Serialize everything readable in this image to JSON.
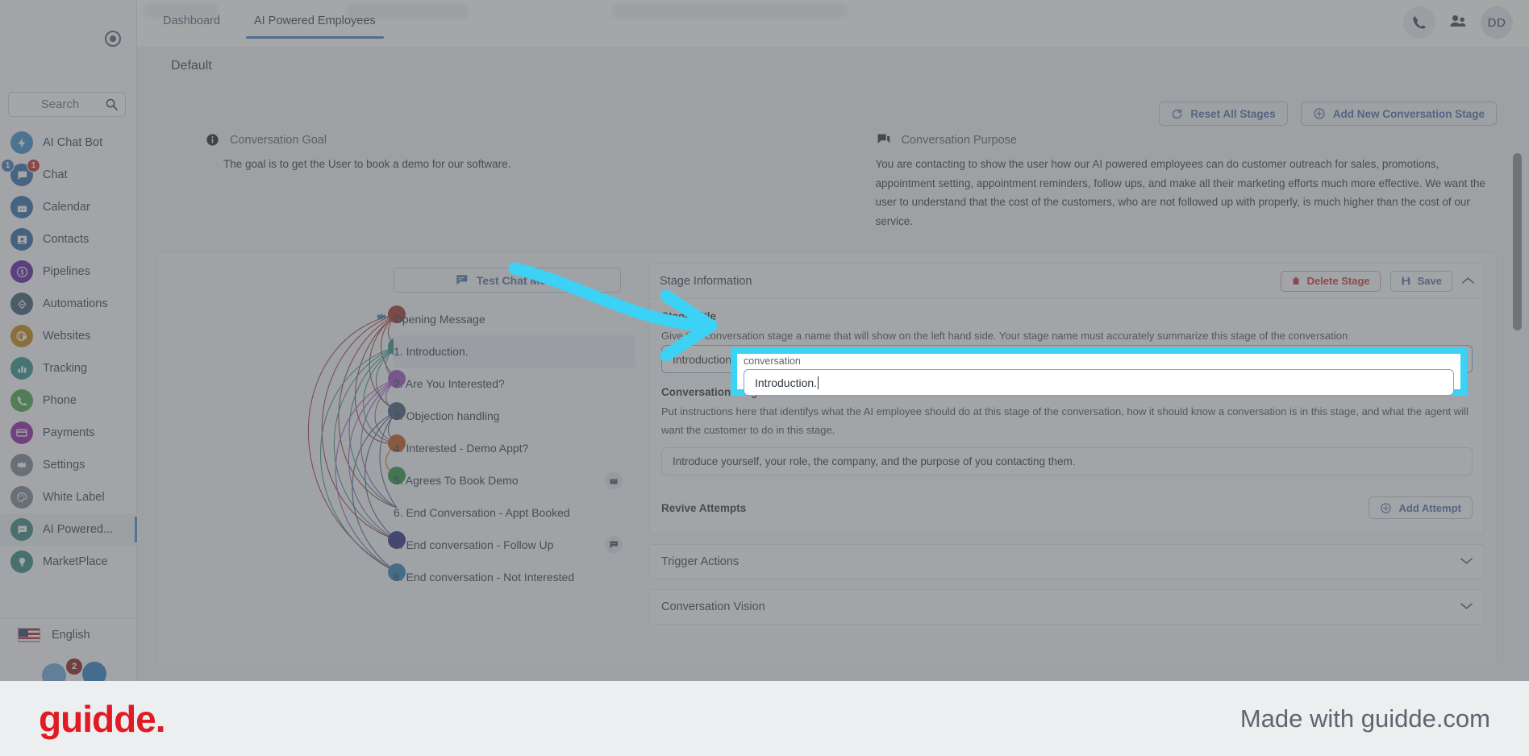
{
  "sidebar": {
    "search_placeholder": "Search",
    "items": [
      {
        "label": "AI Chat Bot",
        "icon": "bolt-icon",
        "color": "#3f8fd0"
      },
      {
        "label": "Chat",
        "icon": "chat-icon",
        "color": "#2f6fae",
        "badge_left": "1",
        "badge_right": "1"
      },
      {
        "label": "Calendar",
        "icon": "calendar-icon",
        "color": "#2d6bab"
      },
      {
        "label": "Contacts",
        "icon": "contacts-icon",
        "color": "#2c68a6"
      },
      {
        "label": "Pipelines",
        "icon": "dollar-icon",
        "color": "#5c1e9e"
      },
      {
        "label": "Automations",
        "icon": "automations-icon",
        "color": "#3b5a72"
      },
      {
        "label": "Websites",
        "icon": "globe-icon",
        "color": "#c8860d"
      },
      {
        "label": "Tracking",
        "icon": "bars-icon",
        "color": "#2f9189"
      },
      {
        "label": "Phone",
        "icon": "phone-icon",
        "color": "#4aa547"
      },
      {
        "label": "Payments",
        "icon": "card-icon",
        "color": "#8d1fa5"
      },
      {
        "label": "Settings",
        "icon": "gear-icon",
        "color": "#7c8592"
      },
      {
        "label": "White Label",
        "icon": "palette-icon",
        "color": "#7c8592"
      },
      {
        "label": "AI Powered...",
        "icon": "ai-chat-icon",
        "color": "#35857e",
        "active": true
      },
      {
        "label": "MarketPlace",
        "icon": "bulb-icon",
        "color": "#2f8a80"
      }
    ],
    "language": "English",
    "chat_badge": "2"
  },
  "topbar": {
    "tabs": [
      {
        "label": "Dashboard",
        "active": false
      },
      {
        "label": "AI Powered Employees",
        "active": true
      }
    ],
    "phone_icon": "phone-icon",
    "people_icon": "people-icon",
    "avatar_initials": "DD"
  },
  "page": {
    "title": "Default",
    "reset_button": "Reset All Stages",
    "add_stage_button": "Add New Conversation Stage",
    "goal": {
      "heading": "Conversation Goal",
      "icon": "info-icon",
      "text": "The goal is to get the User to book a demo for our software."
    },
    "purpose": {
      "heading": "Conversation Purpose",
      "icon": "speech-icon",
      "text": "You are contacting to show the user how our AI powered employees can do customer outreach for sales, promotions, appointment setting, appointment reminders, follow ups, and make all their marketing efforts much more effective. We want the user to understand that the cost of the customers, who are not followed up with properly, is much higher than the cost of our service."
    }
  },
  "stages": {
    "test_chat_button": "Test Chat Mode",
    "opening": {
      "label": "Opening Message",
      "icon": "gear-icon"
    },
    "items": [
      {
        "label": "1. Introduction.",
        "color": "#a2312d",
        "active": true,
        "trailing_icon": null
      },
      {
        "label": "2. Are You Interested?",
        "color": "#329086",
        "active": false,
        "trailing_icon": null
      },
      {
        "label": "3. Objection handling",
        "color": "#9b4fc0",
        "active": false,
        "trailing_icon": null
      },
      {
        "label": "4. Interested - Demo Appt?",
        "color": "#44597c",
        "active": false,
        "trailing_icon": null
      },
      {
        "label": "5. Agrees To Book Demo",
        "color": "#c0561f",
        "active": false,
        "trailing_icon": "calendar-icon"
      },
      {
        "label": "6. End Conversation - Appt Booked",
        "color": "#2a9440",
        "active": false,
        "trailing_icon": null
      },
      {
        "label": "7. End conversation - Follow Up",
        "color": "#2e2a85",
        "active": false,
        "trailing_icon": "chat-icon"
      },
      {
        "label": "8. End conversation - Not Interested",
        "color": "#2f82b8",
        "active": false,
        "trailing_icon": null
      }
    ]
  },
  "stage_panel": {
    "header": "Stage Information",
    "delete_button": "Delete Stage",
    "save_button": "Save",
    "collapse_icon": "chevron-up-icon",
    "stage_title_label": "Stage Title",
    "stage_title_help": "Give this conversation stage a name that will show on the left hand side. Your stage name must accurately summarize this stage of the conversation",
    "stage_title_value": "Introduction.",
    "instructions_label": "Conversation Stage Instructions",
    "instructions_help": "Put instructions here that identifys what the AI employee should do at this stage of the conversation, how it should know a conversation is in this stage, and what the agent will want the customer to do in this stage.",
    "instructions_value": "Introduce yourself, your role, the company, and the purpose of you contacting them.",
    "revive_label": "Revive Attempts",
    "add_attempt_button": "Add Attempt",
    "trigger_actions": "Trigger Actions",
    "conversation_vision": "Conversation Vision"
  },
  "highlight": {
    "ghost_text": "conversation",
    "input_value": "Introduction.",
    "accent_color": "#3bd2f5"
  },
  "footer": {
    "logo": "guidde.",
    "tagline": "Made with guidde.com",
    "logo_color": "#e01b24"
  }
}
